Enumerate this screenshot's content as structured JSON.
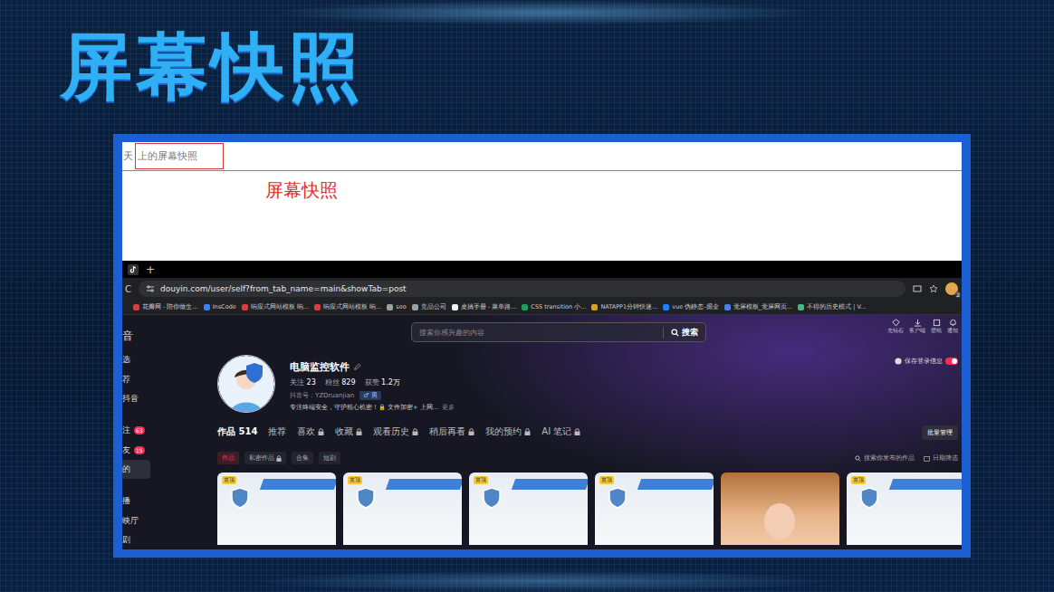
{
  "slide": {
    "title": "屏幕快照"
  },
  "note": {
    "prefix": "天",
    "highlighted": "上的屏幕快照",
    "label": "屏幕快照"
  },
  "browser": {
    "new_tab": "+",
    "reload": "C",
    "url": "douyin.com/user/self?from_tab_name=main&showTab=post",
    "profile_badge": "2",
    "bookmarks": [
      {
        "label": "花瓣网 - 陪你做生...",
        "color": "#e0393e"
      },
      {
        "label": "InsCode",
        "color": "#3b82f6"
      },
      {
        "label": "响应式网站模板 响...",
        "color": "#e0393e"
      },
      {
        "label": "响应式网站模板 响...",
        "color": "#e0393e"
      },
      {
        "label": "seo",
        "color": "#9aa0a6"
      },
      {
        "label": "竞品公司",
        "color": "#9aa0a6"
      },
      {
        "label": "桌搞手册 - 菜单路...",
        "color": "#f1f3f4"
      },
      {
        "label": "CSS transition 小...",
        "color": "#1e9e5a"
      },
      {
        "label": "NATAPP1分钟快速...",
        "color": "#d9a21b"
      },
      {
        "label": "vue 伪静态-掘金",
        "color": "#1e80ff"
      },
      {
        "label": "觉屏模板_觉屏网页...",
        "color": "#4a7ee8"
      },
      {
        "label": "不得的历史模式 | V...",
        "color": "#42b883"
      }
    ]
  },
  "sidebar": {
    "items": [
      {
        "label": "音",
        "kind": "logo",
        "badge": "",
        "selected": false
      },
      {
        "label": "选",
        "kind": "nav",
        "badge": "",
        "selected": false
      },
      {
        "label": "荐",
        "kind": "nav",
        "badge": "",
        "selected": false
      },
      {
        "label": "抖音",
        "kind": "nav",
        "badge": "",
        "selected": false
      },
      {
        "label": "注",
        "kind": "nav",
        "badge": "63",
        "selected": false
      },
      {
        "label": "友",
        "kind": "nav",
        "badge": "15",
        "selected": false
      },
      {
        "label": "的",
        "kind": "nav",
        "badge": "",
        "selected": true
      },
      {
        "label": "播",
        "kind": "nav",
        "badge": "",
        "selected": false
      },
      {
        "label": "映厅",
        "kind": "nav",
        "badge": "",
        "selected": false
      },
      {
        "label": "剧",
        "kind": "nav",
        "badge": "",
        "selected": false
      }
    ]
  },
  "search": {
    "placeholder": "搜索你感兴趣的内容",
    "button": "搜索"
  },
  "header_actions": [
    "充钻石",
    "客户端",
    "壁纸",
    "通知"
  ],
  "profile": {
    "name": "电脑监控软件",
    "stats": [
      {
        "label": "关注",
        "value": "23"
      },
      {
        "label": "粉丝",
        "value": "829"
      },
      {
        "label": "获赞",
        "value": "1.2万"
      }
    ],
    "id": "抖音号：YZDruanjian",
    "gender": "♂ 男",
    "bio": "专注终端安全，守护核心机密！🔒 文件加密+ 上网...",
    "more": "更多"
  },
  "save_login": {
    "label": "保存登录信息",
    "on": true
  },
  "tabs": [
    {
      "label": "作品 514",
      "selected": true,
      "locked": false
    },
    {
      "label": "推荐",
      "selected": false,
      "locked": false
    },
    {
      "label": "喜欢",
      "selected": false,
      "locked": true
    },
    {
      "label": "收藏",
      "selected": false,
      "locked": true
    },
    {
      "label": "观看历史",
      "selected": false,
      "locked": true
    },
    {
      "label": "稍后再看",
      "selected": false,
      "locked": true
    },
    {
      "label": "我的预约",
      "selected": false,
      "locked": true
    },
    {
      "label": "AI 笔记",
      "selected": false,
      "locked": true
    }
  ],
  "batch_button": "批量管理",
  "subtabs": [
    {
      "label": "作品",
      "selected": true,
      "locked": false
    },
    {
      "label": "私密作品",
      "selected": false,
      "locked": true
    },
    {
      "label": "合集",
      "selected": false,
      "locked": false
    },
    {
      "label": "短剧",
      "selected": false,
      "locked": false
    }
  ],
  "works_search": "搜索你发布的作品",
  "date_filter": "日期筛选",
  "videos": [
    {
      "kind": "banner",
      "pinned": true,
      "pin_label": "置顶"
    },
    {
      "kind": "banner",
      "pinned": true,
      "pin_label": "置顶"
    },
    {
      "kind": "banner",
      "pinned": true,
      "pin_label": "置顶"
    },
    {
      "kind": "banner",
      "pinned": true,
      "pin_label": "置顶"
    },
    {
      "kind": "photo",
      "pinned": false,
      "pin_label": ""
    },
    {
      "kind": "banner",
      "pinned": true,
      "pin_label": "置顶"
    }
  ]
}
